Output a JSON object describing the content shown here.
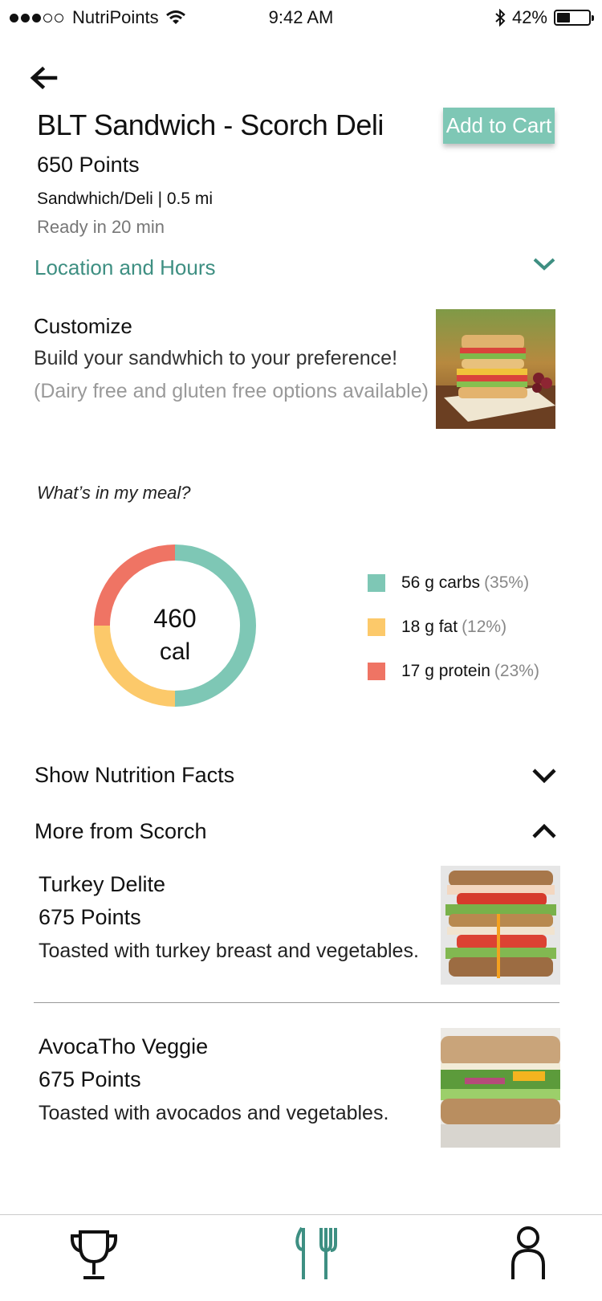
{
  "status_bar": {
    "carrier": "NutriPoints",
    "time": "9:42 AM",
    "battery": "42%",
    "battery_level": 0.42
  },
  "header": {
    "back_icon": "arrow-left-icon",
    "title": "BLT Sandwich - Scorch Deli",
    "points": "650 Points",
    "category": "Sandwhich/Deli | 0.5 mi",
    "ready": "Ready in 20 min",
    "add_to_cart": "Add to Cart"
  },
  "location": {
    "label": "Location and Hours",
    "icon": "chevron-down-icon"
  },
  "customize": {
    "title": "Customize",
    "subtitle": "Build your sandwhich to your preference!",
    "note": "(Dairy free and gluten free options available)",
    "image": "blt-sandwich-photo"
  },
  "meal": {
    "question": "What’s in my meal?",
    "calories": "460",
    "calories_unit": "cal",
    "macros": [
      {
        "label": "56 g carbs",
        "pct": "(35%)",
        "color": "#7ec7b5"
      },
      {
        "label": "18 g fat",
        "pct": "(12%)",
        "color": "#fcc96a"
      },
      {
        "label": "17 g protein",
        "pct": "(23%)",
        "color": "#ef7464"
      }
    ]
  },
  "chart_data": {
    "type": "pie",
    "donut": true,
    "center_label": "460 cal",
    "categories": [
      "56 g carbs",
      "18 g fat",
      "17 g protein"
    ],
    "values": [
      50,
      25,
      25
    ],
    "colors": [
      "#7ec7b5",
      "#fcc96a",
      "#ef7464"
    ]
  },
  "nutrition": {
    "label": "Show Nutrition Facts",
    "icon": "chevron-down-icon"
  },
  "more": {
    "label": "More from Scorch",
    "icon": "chevron-up-icon",
    "items": [
      {
        "name": "Turkey Delite",
        "points": "675 Points",
        "desc": "Toasted with turkey breast and vegetables.",
        "image": "turkey-sandwich-photo"
      },
      {
        "name": "AvocaTho Veggie",
        "points": "675 Points",
        "desc": "Toasted with avocados and vegetables.",
        "image": "veggie-sandwich-photo"
      }
    ]
  },
  "tabbar": {
    "tabs": [
      {
        "icon": "trophy-icon",
        "active": false
      },
      {
        "icon": "fork-knife-icon",
        "active": true
      },
      {
        "icon": "person-icon",
        "active": false
      }
    ],
    "accent": "#3e8f82"
  }
}
